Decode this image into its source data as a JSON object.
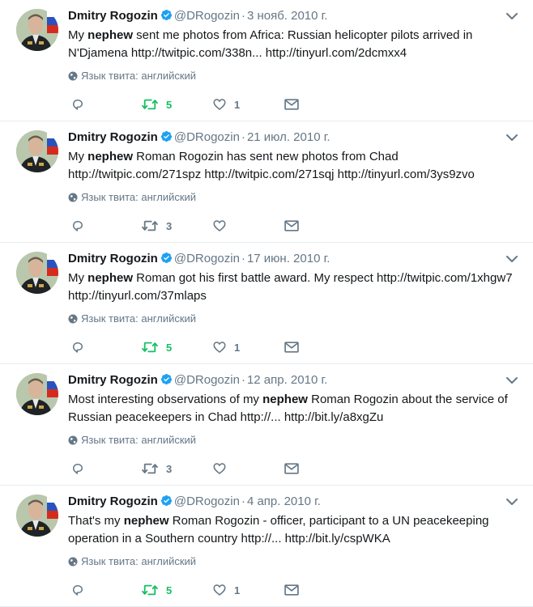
{
  "tweets": [
    {
      "name": "Dmitry Rogozin",
      "handle": "@DRogozin",
      "date": "3 нояб. 2010 г.",
      "text_before": "My ",
      "highlight": "nephew",
      "text_after": " sent me photos from Africa: Russian helicopter pilots arrived in N'Djamena http://twitpic.com/338n... http://tinyurl.com/2dcmxx4",
      "lang": "Язык твита: английский",
      "retweets": "5",
      "retweeted": true,
      "likes": "1"
    },
    {
      "name": "Dmitry Rogozin",
      "handle": "@DRogozin",
      "date": "21 июл. 2010 г.",
      "text_before": "My ",
      "highlight": "nephew",
      "text_after": " Roman Rogozin has sent new photos from Chad http://twitpic.com/271spz http://twitpic.com/271sqj http://tinyurl.com/3ys9zvo",
      "lang": "Язык твита: английский",
      "retweets": "3",
      "retweeted": false,
      "likes": ""
    },
    {
      "name": "Dmitry Rogozin",
      "handle": "@DRogozin",
      "date": "17 июн. 2010 г.",
      "text_before": "My ",
      "highlight": "nephew",
      "text_after": " Roman got his first battle award. My respect http://twitpic.com/1xhgw7 http://tinyurl.com/37mlaps",
      "lang": "Язык твита: английский",
      "retweets": "5",
      "retweeted": true,
      "likes": "1"
    },
    {
      "name": "Dmitry Rogozin",
      "handle": "@DRogozin",
      "date": "12 апр. 2010 г.",
      "text_before": "Most interesting observations of my ",
      "highlight": "nephew",
      "text_after": " Roman Rogozin about the service of Russian peacekeepers in Chad http://... http://bit.ly/a8xgZu",
      "lang": "Язык твита: английский",
      "retweets": "3",
      "retweeted": false,
      "likes": ""
    },
    {
      "name": "Dmitry Rogozin",
      "handle": "@DRogozin",
      "date": "4 апр. 2010 г.",
      "text_before": "That's my ",
      "highlight": "nephew",
      "text_after": " Roman Rogozin - officer, participant to a UN peacekeeping operation in a Southern country http://... http://bit.ly/cspWKA",
      "lang": "Язык твита: английский",
      "retweets": "5",
      "retweeted": true,
      "likes": "1"
    }
  ],
  "colors": {
    "verified": "#1da1f2",
    "retweet_active": "#17bf63",
    "icon_gray": "#657786",
    "divider": "#e6ecf0"
  },
  "icons": {
    "verified": "verified-badge-icon",
    "caret": "chevron-down-icon",
    "globe": "globe-icon",
    "reply": "reply-icon",
    "retweet": "retweet-icon",
    "like": "heart-icon",
    "dm": "envelope-icon"
  }
}
